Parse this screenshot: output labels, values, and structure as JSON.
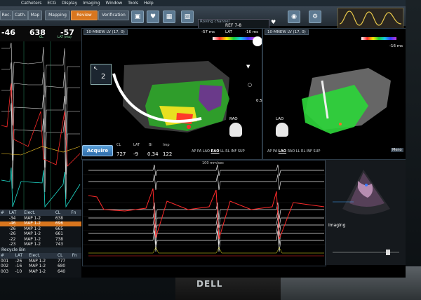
{
  "menu": [
    "Catheters",
    "ECG",
    "Display",
    "Imaging",
    "Window",
    "Tools",
    "Help"
  ],
  "toolbar": {
    "tabs": [
      {
        "label": "Rec.",
        "active": false
      },
      {
        "label": "Cath.",
        "active": false
      },
      {
        "label": "Map",
        "active": false
      },
      {
        "label": "Mapping",
        "active": false
      },
      {
        "label": "Review",
        "active": true
      },
      {
        "label": "Verification",
        "active": false
      }
    ],
    "roving_label": "Roving channel",
    "roving_value": "REF 7-8"
  },
  "left_header": {
    "val1": "-46",
    "val2": "638",
    "val3": "-57",
    "lab_cl": "CL",
    "lab_lat": "LAT (ms)"
  },
  "map_left": {
    "title": "10-MNEW LV (17, 0)",
    "lat_min": "-57 ms",
    "lat_label": "LAT",
    "lat_max": "-16 ms",
    "zoom": "2",
    "orientation": "RAO",
    "scale_top": "0.53",
    "scale_bot": "0.53",
    "views": [
      "AP",
      "PA",
      "LAO",
      "RAO",
      "LL",
      "RL",
      "INF",
      "SUP"
    ],
    "active_view": "RAO"
  },
  "map_right": {
    "title": "10-MNEW LV (17, 0)",
    "lat_max": "-16 ms",
    "orientation": "LAO",
    "views": [
      "AP",
      "PA",
      "LAO",
      "RAO",
      "LL",
      "RL",
      "INF",
      "SUP"
    ],
    "active_view": "LAO",
    "menu_label": "Meno"
  },
  "acquire": {
    "button": "Acquire",
    "headers": [
      "CL",
      "LAT",
      "Bi",
      "Imp"
    ],
    "values": [
      "727",
      "-9",
      "0.34",
      "122"
    ]
  },
  "signals": {
    "sweep_label": "100 mm/sec"
  },
  "echo": {
    "label": "Imaging"
  },
  "points_table": {
    "columns": [
      "#",
      "LAT",
      "Elect.",
      "CL",
      "Fn"
    ],
    "rows": [
      {
        "n": "",
        "lat": "-34",
        "elect": "MAP 1-2",
        "cl": "638",
        "sel": false
      },
      {
        "n": "",
        "lat": "-46",
        "elect": "MAP 1-2",
        "cl": "696",
        "sel": true
      },
      {
        "n": "",
        "lat": "-26",
        "elect": "MAP 1-2",
        "cl": "665",
        "sel": false
      },
      {
        "n": "",
        "lat": "-26",
        "elect": "MAP 1-2",
        "cl": "661",
        "sel": false
      },
      {
        "n": "",
        "lat": "-22",
        "elect": "MAP 1-2",
        "cl": "738",
        "sel": false
      },
      {
        "n": "",
        "lat": "-23",
        "elect": "MAP 1-2",
        "cl": "743",
        "sel": false
      }
    ]
  },
  "bin": {
    "title": "Recycle Bin",
    "columns": [
      "#",
      "LAT",
      "Elect.",
      "CL",
      "Fn"
    ],
    "rows": [
      {
        "n": "001",
        "lat": "-26",
        "elect": "MAP 1-2",
        "cl": "777"
      },
      {
        "n": "002",
        "lat": "-16",
        "elect": "MAP 1-2",
        "cl": "680"
      },
      {
        "n": "003",
        "lat": "-10",
        "elect": "MAP 1-2",
        "cl": "640"
      }
    ]
  },
  "monitor_brand": "DELL"
}
